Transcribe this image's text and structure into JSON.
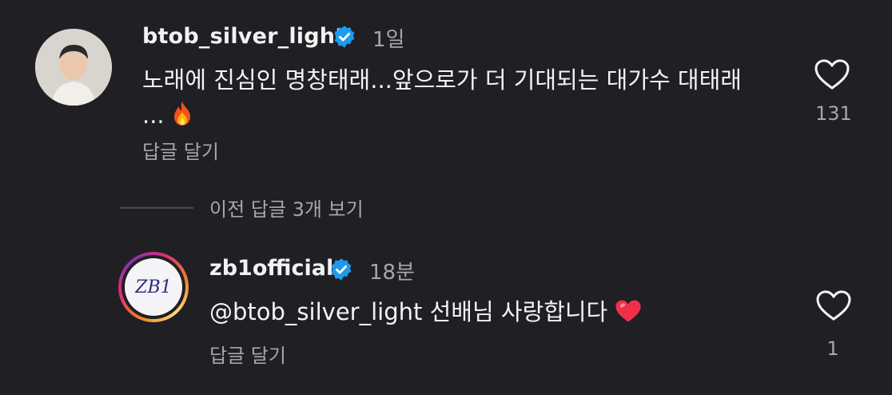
{
  "comments": [
    {
      "username": "btob_silver_light",
      "time": "1일",
      "text": "노래에 진심인 명창태래...앞으로가 더 기대되는 대가수 대태래 ...",
      "emoji": "fire",
      "reply_label": "답글 달기",
      "like_count": "131"
    },
    {
      "username": "zb1official",
      "time": "18분",
      "mention": "@btob_silver_light",
      "text": " 선배님 사랑합니다",
      "emoji": "red-heart",
      "reply_label": "답글 달기",
      "like_count": "1"
    }
  ],
  "view_previous_replies": "이전 답글 3개 보기",
  "avatar_logo_text": "ZB1",
  "colors": {
    "background": "#1f1f24",
    "verified": "#1d9bf0",
    "secondary_text": "#a6a6ab"
  },
  "icons": [
    "verified-badge-icon",
    "heart-outline-icon",
    "fire-emoji-icon",
    "red-heart-emoji-icon"
  ]
}
